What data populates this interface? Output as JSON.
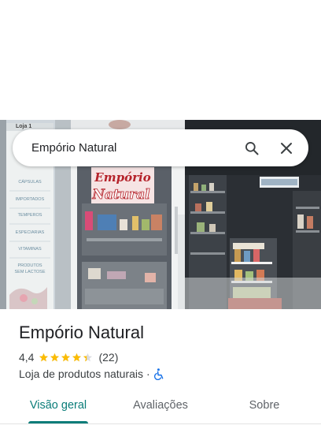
{
  "search": {
    "value": "Empório Natural"
  },
  "photo": {
    "sign_line1": "Empório",
    "sign_line2": "Natural",
    "banner_top": "Loja 1",
    "banner_items": [
      "CÁPSULAS",
      "IMPORTADOS",
      "TEMPEROS",
      "ESPECIARIAS",
      "VITAMINAS",
      "PRODUTOS",
      "SEM LACTOSE"
    ]
  },
  "place": {
    "title": "Empório Natural",
    "rating": "4,4",
    "stars_value": 4.4,
    "review_count": "(22)",
    "category": "Loja de produtos naturais",
    "separator": "·",
    "accessibility_icon": "wheelchair-icon"
  },
  "tabs": [
    {
      "label": "Visão geral",
      "active": true
    },
    {
      "label": "Avaliações",
      "active": false
    },
    {
      "label": "Sobre",
      "active": false
    }
  ],
  "colors": {
    "accent": "#0b7d79",
    "star": "#fbbc04",
    "accessibility": "#1a73e8",
    "sign_red": "#b5232b"
  }
}
